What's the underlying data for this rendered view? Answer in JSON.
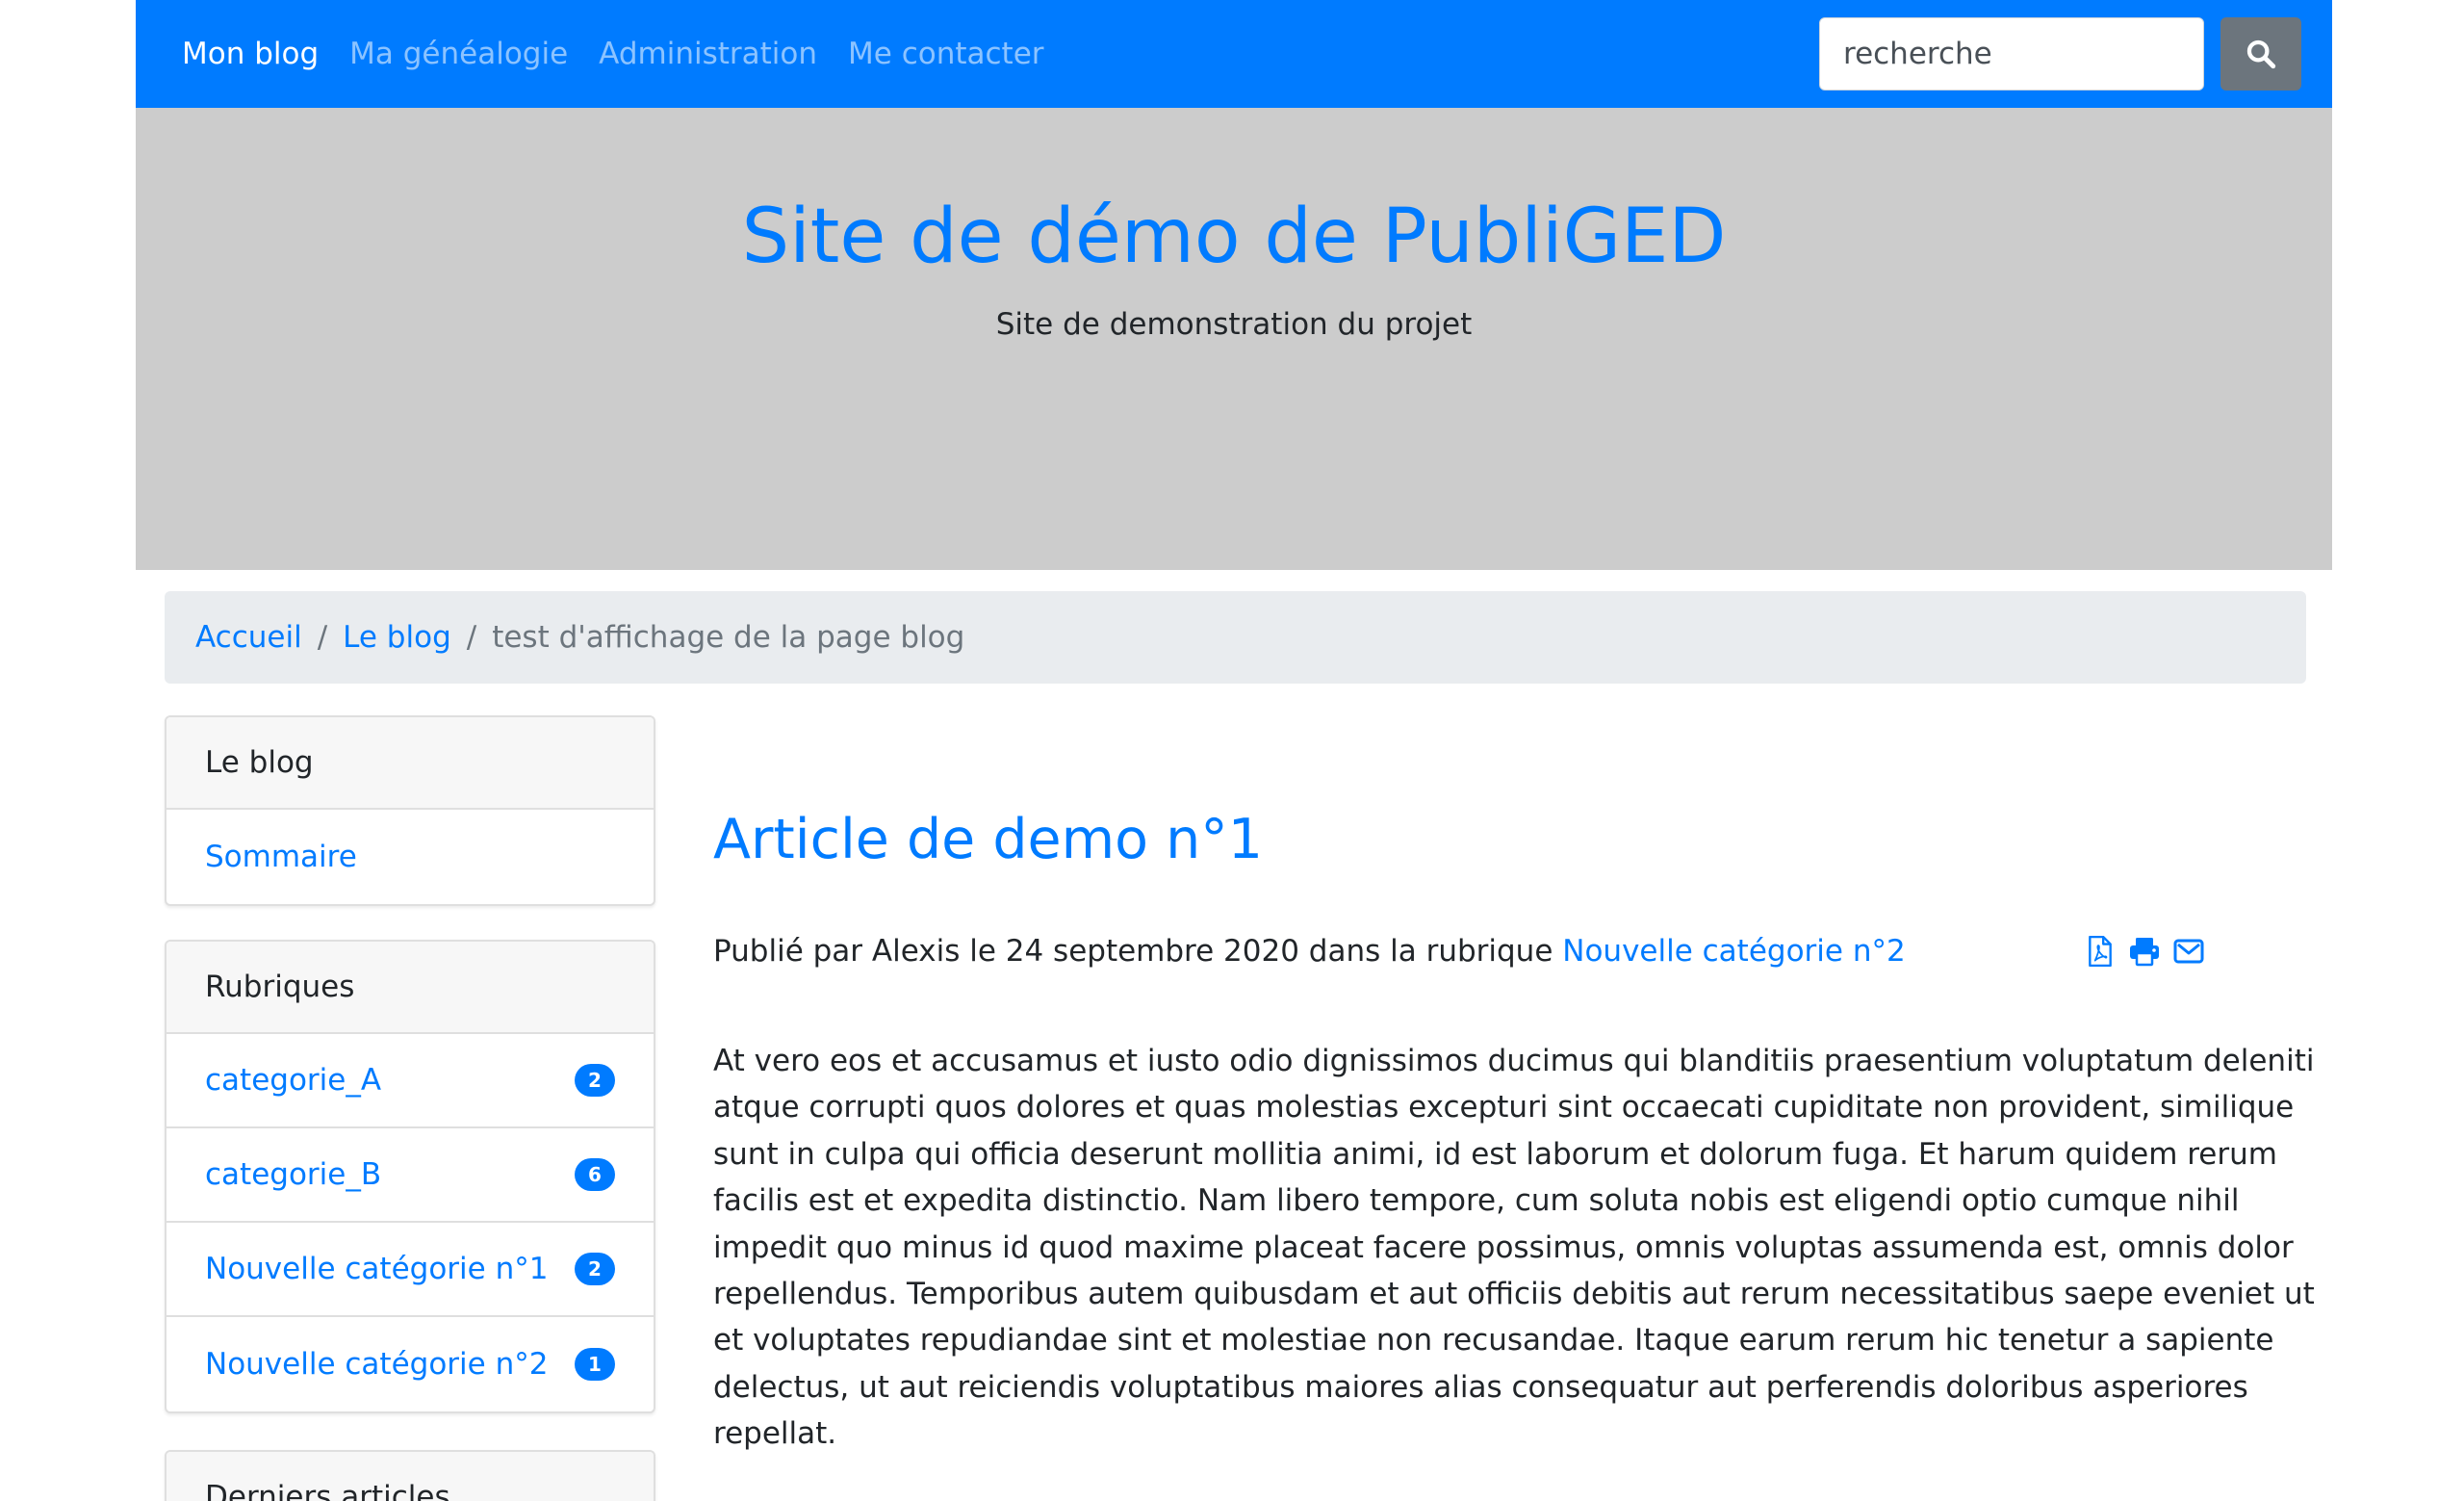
{
  "navbar": {
    "brand": "Mon blog",
    "links": [
      "Ma généalogie",
      "Administration",
      "Me contacter"
    ],
    "search_placeholder": "recherche",
    "search_icon": "search-icon"
  },
  "hero": {
    "title": "Site de démo de PubliGED",
    "subtitle": "Site de demonstration du projet"
  },
  "breadcrumb": {
    "items": [
      "Accueil",
      "Le blog"
    ],
    "active": "test d'affichage de la page blog",
    "separator": "/"
  },
  "sidebar": {
    "blog_card": {
      "header": "Le blog",
      "items": [
        "Sommaire"
      ]
    },
    "categories_card": {
      "header": "Rubriques",
      "items": [
        {
          "label": "categorie_A",
          "count": "2"
        },
        {
          "label": "categorie_B",
          "count": "6"
        },
        {
          "label": "Nouvelle catégorie n°1",
          "count": "2"
        },
        {
          "label": "Nouvelle catégorie n°2",
          "count": "1"
        }
      ]
    },
    "recent_card": {
      "header": "Derniers articles"
    }
  },
  "article": {
    "title": "Article de demo n°1",
    "meta_prefix": "Publié par Alexis le 24 septembre 2020 dans la rubrique ",
    "category_link": "Nouvelle catégorie n°2",
    "tools": [
      "pdf-icon",
      "print-icon",
      "email-icon"
    ],
    "body": "At vero eos et accusamus et iusto odio dignissimos ducimus qui blanditiis praesentium voluptatum deleniti atque corrupti quos dolores et quas molestias excepturi sint occaecati cupiditate non provident, similique sunt in culpa qui officia deserunt mollitia animi, id est laborum et dolorum fuga. Et harum quidem rerum facilis est et expedita distinctio. Nam libero tempore, cum soluta nobis est eligendi optio cumque nihil impedit quo minus id quod maxime placeat facere possimus, omnis voluptas assumenda est, omnis dolor repellendus. Temporibus autem quibusdam et aut officiis debitis aut rerum necessitatibus saepe eveniet ut et voluptates repudiandae sint et molestiae non recusandae. Itaque earum rerum hic tenetur a sapiente delectus, ut aut reiciendis voluptatibus maiores alias consequatur aut perferendis doloribus asperiores repellat."
  },
  "colors": {
    "primary": "#007bff",
    "hero_background": "#cccccc",
    "breadcrumb_background": "#e9ecef",
    "search_button": "#6c757d"
  }
}
